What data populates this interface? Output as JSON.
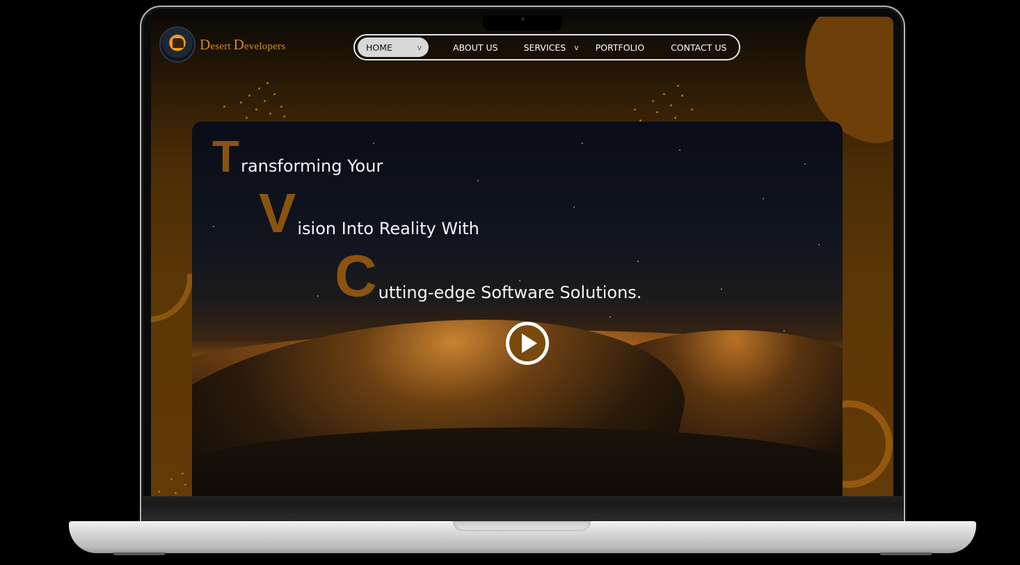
{
  "brand": {
    "name_cap1": "D",
    "name_rest1": "esert ",
    "name_cap2": "D",
    "name_rest2": "evelopers",
    "logo_icon": "goat-emblem-icon"
  },
  "nav": {
    "items": [
      {
        "label": "HOME",
        "has_dropdown": true,
        "active": true
      },
      {
        "label": "ABOUT US",
        "has_dropdown": false
      },
      {
        "label": "SERVICES",
        "has_dropdown": true
      },
      {
        "label": "PORTFOLIO",
        "has_dropdown": false
      },
      {
        "label": "CONTACT US",
        "has_dropdown": false
      }
    ],
    "dropdown_glyph": "v"
  },
  "hero": {
    "lines": [
      {
        "initial": "T",
        "rest": "ransforming Your"
      },
      {
        "initial": "V",
        "rest": "ision Into Reality With"
      },
      {
        "initial": "C",
        "rest": "utting-edge Software Solutions."
      }
    ],
    "play_icon": "play-icon"
  },
  "colors": {
    "accent": "#8b5310",
    "brand_text": "#d48a1e",
    "nav_active_bg": "#d8d8d8",
    "screen_bg": "#5b3606"
  }
}
